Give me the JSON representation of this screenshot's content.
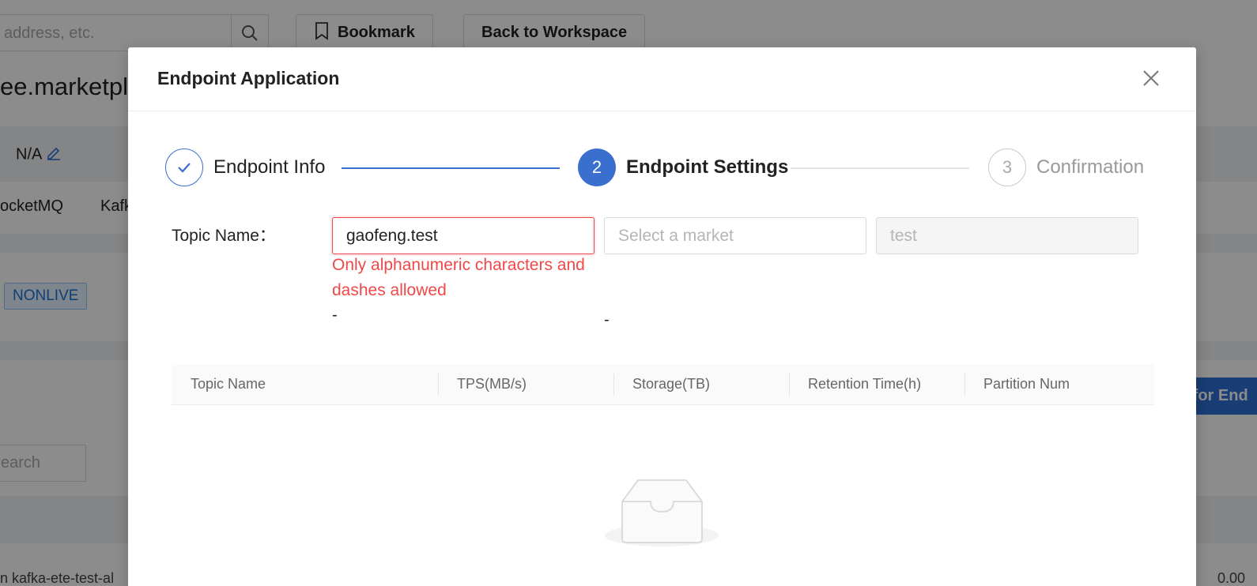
{
  "background": {
    "search_placeholder": "address, etc.",
    "bookmark_label": "Bookmark",
    "back_label": "Back to Workspace",
    "page_title": "ee.marketpla",
    "owner_value": "N/A",
    "tab_rocketmq": "ocketMQ",
    "tab_kafka": "Kafk",
    "status_tag": "NONLIVE",
    "apply_button": "y for End",
    "search_small": "earch",
    "footer_left": "n kafka-ete-test-al",
    "footer_right": "0.00"
  },
  "modal": {
    "title": "Endpoint Application",
    "steps": [
      {
        "number": "1",
        "label": "Endpoint Info",
        "status": "done"
      },
      {
        "number": "2",
        "label": "Endpoint Settings",
        "status": "active"
      },
      {
        "number": "3",
        "label": "Confirmation",
        "status": "wait"
      }
    ],
    "form": {
      "topic_label": "Topic Name：",
      "topic_value": "gaofeng.test",
      "market_placeholder": "Select a market",
      "suffix_value": "test",
      "error": "Only alphanumeric characters and dashes allowed",
      "dash1": "-",
      "dash2": "-"
    },
    "table": {
      "columns": [
        "Topic Name",
        "TPS(MB/s)",
        "Storage(TB)",
        "Retention Time(h)",
        "Partition Num"
      ]
    }
  },
  "colors": {
    "primary": "#3b6fcf",
    "error": "#f04848"
  }
}
